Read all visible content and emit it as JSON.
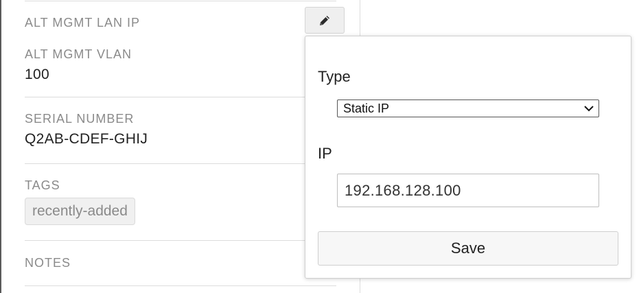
{
  "details": {
    "alt_mgmt_lan_ip_label": "ALT MGMT LAN IP",
    "alt_mgmt_vlan_label": "ALT MGMT VLAN",
    "alt_mgmt_vlan_value": "100",
    "serial_number_label": "SERIAL NUMBER",
    "serial_number_value": "Q2AB-CDEF-GHIJ",
    "tags_label": "TAGS",
    "tags": [
      "recently-added"
    ],
    "notes_label": "NOTES"
  },
  "icons": {
    "edit": "pencil-icon",
    "select_arrow": "chevron-down-icon"
  },
  "popover": {
    "type_label": "Type",
    "type_selected": "Static IP",
    "ip_label": "IP",
    "ip_value": "192.168.128.100",
    "save_label": "Save"
  }
}
